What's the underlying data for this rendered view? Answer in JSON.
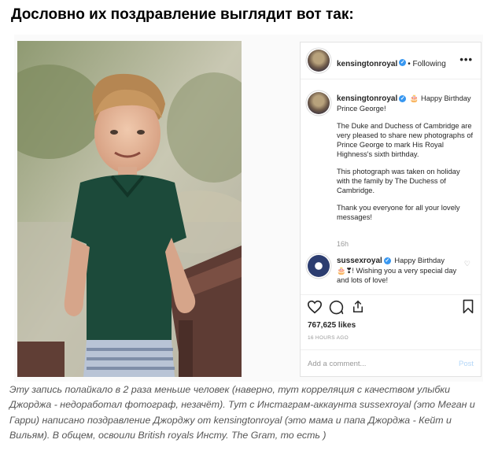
{
  "heading": "Дословно их поздравление выглядит вот так:",
  "post": {
    "account": "kensingtonroyal",
    "follow_label": "• Following",
    "menu_label": "•••",
    "caption_account": "kensingtonroyal",
    "caption_p1": "🎂 Happy Birthday Prince George!",
    "caption_p2": "The Duke and Duchess of Cambridge are very pleased to share new photographs of Prince George to mark His Royal Highness's sixth birthday.",
    "caption_p3": "This photograph was taken on holiday with the family by The Duchess of Cambridge.",
    "caption_p4": "Thank you everyone for all your lovely messages!",
    "time": "16h",
    "comment_account": "sussexroyal",
    "comment_text": "Happy Birthday 🎂❣! Wishing you a very special day and lots of love!",
    "likes": "767,625 likes",
    "ago": "16 HOURS AGO",
    "add_comment_placeholder": "Add a comment...",
    "post_button": "Post"
  },
  "icons": [
    "heart-icon",
    "comment-icon",
    "share-icon",
    "bookmark-icon",
    "verified-icon",
    "more-icon"
  ],
  "colors": {
    "verified": "#3897f0",
    "post_button": "#b4d7f8",
    "muted": "#999999"
  },
  "note": "Эту запись полайкало в 2 раза меньше человек (наверно, тут корреляция с качеством улыбки Джорджа - недоработал фотограф, незачёт). Тут с Инстаграм-аккаунта sussexroyal (это Меган и Гарри) написано поздравление Джорджу от kensingtonroyal (это мама и папа Джорджа - Кейт и Вильям). В общем, освоили British royals Инсту. The Gram, то есть )"
}
